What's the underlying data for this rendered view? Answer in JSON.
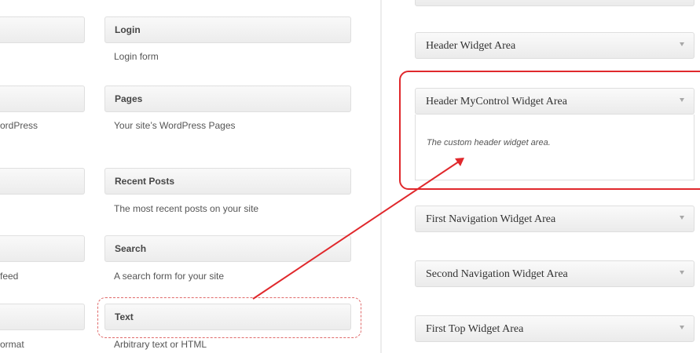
{
  "available_widgets": [
    {
      "title": "Login",
      "description": "Login form"
    },
    {
      "title": "Pages",
      "description": "Your site’s WordPress Pages"
    },
    {
      "title": "Recent Posts",
      "description": "The most recent posts on your site"
    },
    {
      "title": "Search",
      "description": "A search form for your site"
    },
    {
      "title": "Text",
      "description": "Arbitrary text or HTML"
    }
  ],
  "left_column_fragments": [
    "ordPress",
    "feed",
    "ormat"
  ],
  "sidebars": [
    {
      "title": "Header Widget Area"
    },
    {
      "title": "Header MyControl Widget Area",
      "description": "The custom header widget area."
    },
    {
      "title": "First Navigation Widget Area"
    },
    {
      "title": "Second Navigation Widget Area"
    },
    {
      "title": "First Top Widget Area"
    }
  ],
  "colors": {
    "highlight": "#e0282c",
    "arrow": "#e0282c"
  },
  "icons": {
    "sidebar_toggle": "chevron-down-icon",
    "drag_arrow": "arrow-icon"
  }
}
